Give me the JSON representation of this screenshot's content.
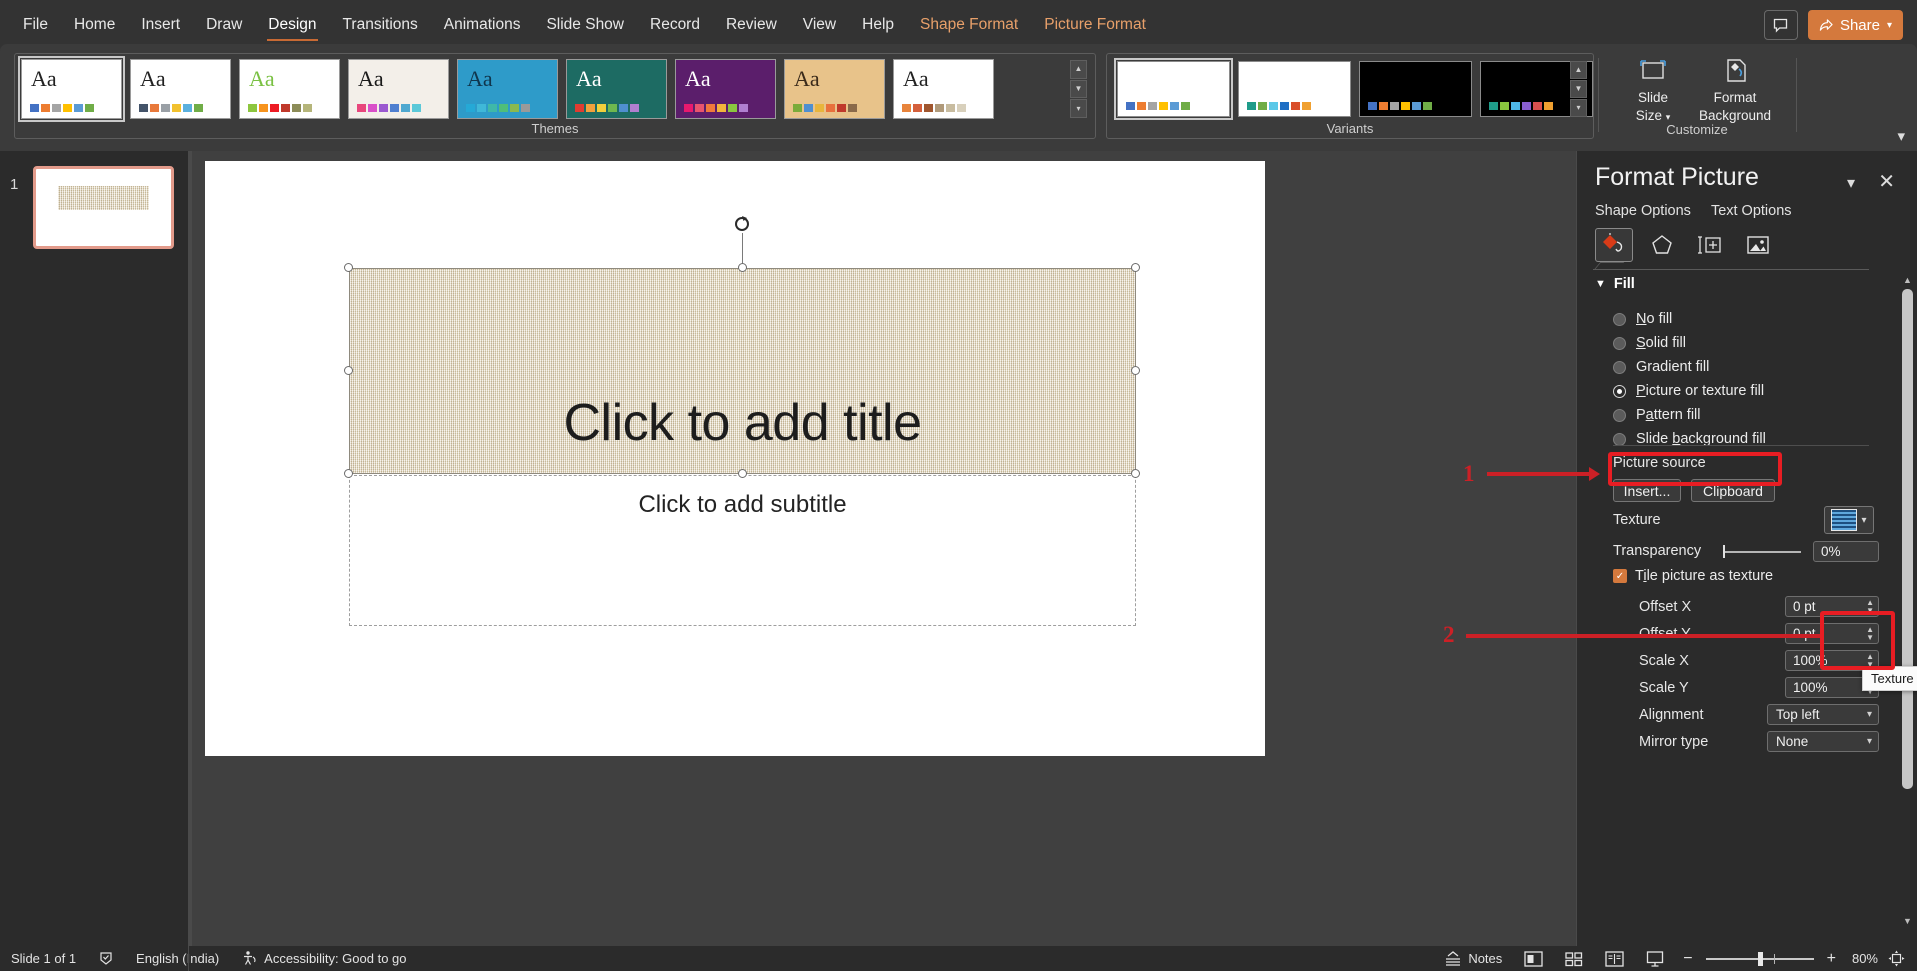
{
  "app": {
    "ribbon_tabs": [
      {
        "label": "File",
        "state": "normal"
      },
      {
        "label": "Home",
        "state": "normal"
      },
      {
        "label": "Insert",
        "state": "normal"
      },
      {
        "label": "Draw",
        "state": "normal"
      },
      {
        "label": "Design",
        "state": "active"
      },
      {
        "label": "Transitions",
        "state": "normal"
      },
      {
        "label": "Animations",
        "state": "normal"
      },
      {
        "label": "Slide Show",
        "state": "normal"
      },
      {
        "label": "Record",
        "state": "normal"
      },
      {
        "label": "Review",
        "state": "normal"
      },
      {
        "label": "View",
        "state": "normal"
      },
      {
        "label": "Help",
        "state": "normal"
      },
      {
        "label": "Shape Format",
        "state": "contextual"
      },
      {
        "label": "Picture Format",
        "state": "contextual"
      }
    ],
    "share_label": "Share",
    "share_color": "#d4793d",
    "comment_icon": "comment-icon",
    "collapse_ribbon_icon": "chevron-down-icon"
  },
  "ribbon": {
    "groups": [
      {
        "name": "Themes",
        "label": "Themes"
      },
      {
        "name": "Variants",
        "label": "Variants"
      },
      {
        "name": "Customize",
        "label": "Customize"
      }
    ],
    "themes": [
      {
        "name": "office-theme",
        "aa": "Aa",
        "selected": true,
        "bg": "#ffffff",
        "aa_color": "#222222",
        "swatches": [
          "#4472c4",
          "#ed7d31",
          "#a5a5a5",
          "#ffc000",
          "#5b9bd5",
          "#70ad47"
        ]
      },
      {
        "name": "theme-2",
        "aa": "Aa",
        "selected": false,
        "bg": "#ffffff",
        "aa_color": "#222222",
        "swatches": [
          "#44546a",
          "#e8793b",
          "#9aa0a6",
          "#f2c12e",
          "#5bb0de",
          "#70ad47"
        ]
      },
      {
        "name": "theme-berlin",
        "aa": "Aa",
        "selected": false,
        "bg": "#ffffff",
        "aa_color": "#7ac143",
        "swatches": [
          "#8dc63f",
          "#f7941e",
          "#ed1c24",
          "#c0392b",
          "#8c8c58",
          "#b5b57a"
        ]
      },
      {
        "name": "theme-badge",
        "aa": "Aa",
        "selected": false,
        "bg": "#f3efe9",
        "aa_color": "#1a1a1a",
        "swatches": [
          "#e8467c",
          "#d94fc9",
          "#9b59d0",
          "#4f7fd0",
          "#4fa8d0",
          "#5bc8d8"
        ]
      },
      {
        "name": "theme-damask",
        "aa": "Aa",
        "selected": false,
        "bg": "#2e9bc9",
        "aa_color": "#10364d",
        "swatches": [
          "#25a9d6",
          "#3fb8d8",
          "#3fb8a8",
          "#4fbe7a",
          "#8ab94f",
          "#9a9a9a"
        ]
      },
      {
        "name": "theme-dividend",
        "aa": "Aa",
        "selected": false,
        "bg": "#1d6b63",
        "aa_color": "#ffffff",
        "swatches": [
          "#e03c31",
          "#f2a03c",
          "#f2cf3c",
          "#6fb84f",
          "#4f8fd0",
          "#b07fd0"
        ]
      },
      {
        "name": "theme-frame",
        "aa": "Aa",
        "selected": false,
        "bg": "#5b1e6b",
        "aa_color": "#ffffff",
        "swatches": [
          "#e8196e",
          "#e8546e",
          "#f07a3c",
          "#f2b43c",
          "#8ac63f",
          "#b07fd0"
        ]
      },
      {
        "name": "theme-wood",
        "aa": "Aa",
        "selected": false,
        "bg": "#e8c38a",
        "aa_color": "#3a2a1a",
        "swatches": [
          "#7aab3a",
          "#4f8fd0",
          "#e8b53c",
          "#e8703c",
          "#c0392b",
          "#8a6a4a"
        ]
      },
      {
        "name": "theme-wisp",
        "aa": "Aa",
        "selected": false,
        "bg": "#ffffff",
        "aa_color": "#222222",
        "swatches": [
          "#e8843c",
          "#d4603c",
          "#a0562e",
          "#b09a7a",
          "#c8bca0",
          "#d8d0bc"
        ]
      }
    ],
    "variants": [
      {
        "name": "variant-1",
        "selected": true,
        "bg": "#ffffff",
        "swatches": [
          "#4472c4",
          "#ed7d31",
          "#a5a5a5",
          "#ffc000",
          "#5b9bd5",
          "#70ad47"
        ]
      },
      {
        "name": "variant-2",
        "selected": false,
        "bg": "#ffffff",
        "swatches": [
          "#1f9c8a",
          "#70ad47",
          "#5bc8e8",
          "#1f6fc4",
          "#d94f2b",
          "#f0a030"
        ]
      },
      {
        "name": "variant-3",
        "selected": false,
        "bg": "#000000",
        "swatches": [
          "#4472c4",
          "#ed7d31",
          "#a5a5a5",
          "#ffc000",
          "#5b9bd5",
          "#70ad47"
        ]
      },
      {
        "name": "variant-4",
        "selected": false,
        "bg": "#000000",
        "swatches": [
          "#1f9c8a",
          "#8ac63f",
          "#4fb8e8",
          "#8a5fd0",
          "#d94f4f",
          "#f0a030"
        ]
      }
    ],
    "customize": [
      {
        "name": "slide-size",
        "line1": "Slide",
        "line2": "Size"
      },
      {
        "name": "format-background",
        "line1": "Format",
        "line2": "Background"
      }
    ]
  },
  "slides_pane": {
    "slides": [
      {
        "number": "1",
        "selected": true
      }
    ]
  },
  "slide": {
    "title_placeholder": "Click to add title",
    "subtitle_placeholder": "Click to add subtitle",
    "title_fill": "texture-linen",
    "title_fill_color": "#e3d6b9"
  },
  "format_picture": {
    "title": "Format Picture",
    "collapse_icon": "chevron-down-icon",
    "close_icon": "close-icon",
    "tabs": [
      {
        "label": "Shape Options",
        "active": true
      },
      {
        "label": "Text Options",
        "active": false
      }
    ],
    "category_icons": [
      {
        "name": "fill-and-line-icon",
        "active": true
      },
      {
        "name": "effects-pentagon-icon",
        "active": false
      },
      {
        "name": "size-and-properties-icon",
        "active": false
      },
      {
        "name": "picture-icon",
        "active": false
      }
    ],
    "fill_section": {
      "header": "Fill",
      "expand_icon": "chevron-down-icon",
      "options": [
        {
          "label": "No fill",
          "underline_index": 0,
          "selected": false,
          "name": "radio-no-fill"
        },
        {
          "label": "Solid fill",
          "underline_index": 0,
          "selected": false,
          "name": "radio-solid-fill"
        },
        {
          "label": "Gradient fill",
          "underline_index": -1,
          "selected": false,
          "name": "radio-gradient-fill"
        },
        {
          "label": "Picture or texture fill",
          "underline_index": 0,
          "selected": true,
          "name": "radio-picture-or-texture-fill"
        },
        {
          "label": "Pattern fill",
          "underline_index": 1,
          "selected": false,
          "name": "radio-pattern-fill"
        },
        {
          "label": "Slide background fill",
          "underline_index": 6,
          "selected": false,
          "name": "radio-slide-background-fill"
        }
      ],
      "picture_source_label": "Picture source",
      "insert_button": "Insert...",
      "clipboard_button": "Clipboard",
      "texture_label": "Texture",
      "texture_dropdown_icon": "chevron-down-icon",
      "texture_swatch_name": "blue-tissue-paper-texture-swatch",
      "transparency_label": "Transparency",
      "transparency_value": "0%",
      "tile_checkbox_label": "Tile picture as texture",
      "tile_checkbox_checked": true,
      "fields": [
        {
          "label": "Offset X",
          "value": "0 pt",
          "type": "spinner",
          "name": "offset-x-field"
        },
        {
          "label": "Offset Y",
          "value": "0 pt",
          "type": "spinner",
          "name": "offset-y-field"
        },
        {
          "label": "Scale X",
          "value": "100%",
          "type": "spinner",
          "name": "scale-x-field"
        },
        {
          "label": "Scale Y",
          "value": "100%",
          "type": "spinner",
          "name": "scale-y-field"
        },
        {
          "label": "Alignment",
          "value": "Top left",
          "type": "combo",
          "name": "alignment-select"
        },
        {
          "label": "Mirror type",
          "value": "None",
          "type": "combo",
          "name": "mirror-type-select"
        }
      ]
    },
    "tooltip": "Texture"
  },
  "annotations": [
    {
      "number": "1",
      "target": "picture-or-texture-fill-option"
    },
    {
      "number": "2",
      "target": "texture-dropdown-button"
    }
  ],
  "status_bar": {
    "slide_count": "Slide 1 of 1",
    "notes_icon": "notes-icon",
    "language": "English (India)",
    "accessibility": "Accessibility: Good to go",
    "accessibility_icon": "accessibility-icon",
    "spellcheck_icon": "spellcheck-icon",
    "notes_label": "Notes",
    "views": [
      {
        "name": "normal-view-button",
        "icon": "normal-view-icon"
      },
      {
        "name": "slide-sorter-button",
        "icon": "slide-sorter-icon"
      },
      {
        "name": "reading-view-button",
        "icon": "reading-view-icon"
      },
      {
        "name": "slideshow-button",
        "icon": "slideshow-icon"
      }
    ],
    "zoom_out_icon": "minus-icon",
    "zoom_in_icon": "plus-icon",
    "zoom_level": "80%",
    "fit_icon": "fit-to-window-icon"
  }
}
